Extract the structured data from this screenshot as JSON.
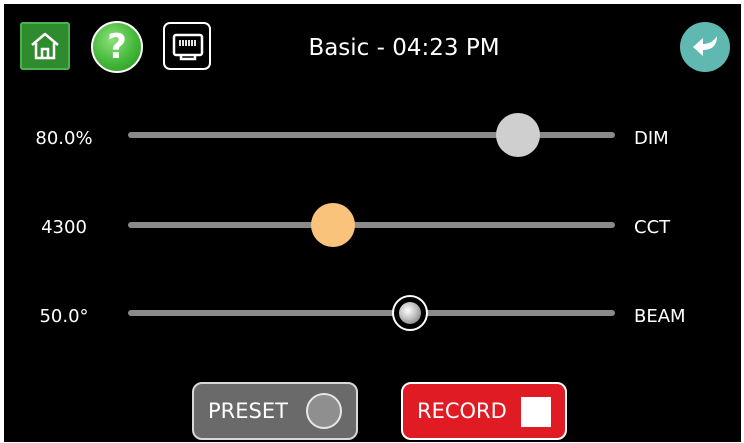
{
  "header": {
    "title": "Basic - 04:23 PM",
    "icons": {
      "home": "home-icon",
      "help": "help-icon",
      "network": "ethernet-port-icon",
      "back": "back-arrow-icon"
    },
    "help_glyph": "?"
  },
  "sliders": [
    {
      "name": "DIM",
      "value_text": "80.0%",
      "level": 0.8,
      "thumb_color": "#cfcfcf"
    },
    {
      "name": "CCT",
      "value_text": "4300",
      "level": 0.42,
      "thumb_color": "#f9c37c"
    },
    {
      "name": "BEAM",
      "value_text": "50.0°",
      "level": 0.58,
      "thumb_color": "#c8c8c8"
    }
  ],
  "buttons": {
    "preset_label": "PRESET",
    "record_label": "RECORD"
  },
  "colors": {
    "background": "#000000",
    "home": "#2e8b2e",
    "help": "#43b83a",
    "back": "#5fb9b1",
    "record": "#e01b24",
    "preset": "#6a6a6a"
  }
}
